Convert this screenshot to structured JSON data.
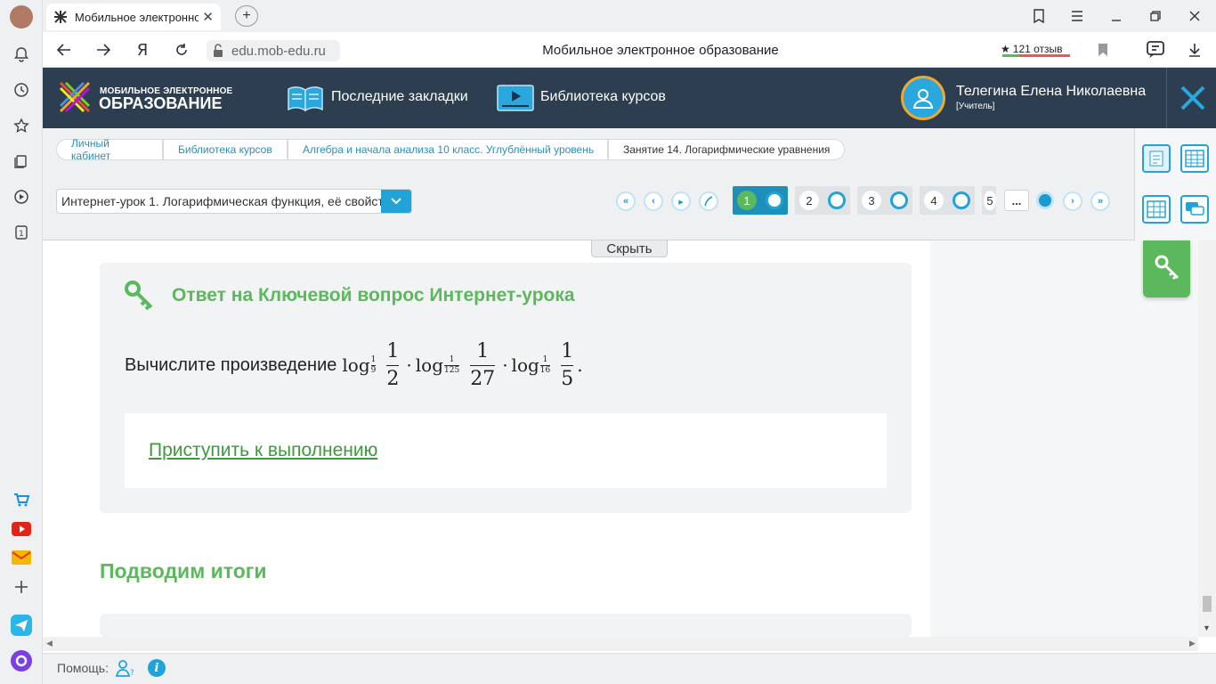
{
  "browser": {
    "tab_title": "Мобильное электронно",
    "address": "edu.mob-edu.ru",
    "page_title": "Мобильное электронное образование",
    "reviews": "121 отзыв"
  },
  "header": {
    "logo_top": "МОБИЛЬНОЕ ЭЛЕКТРОННОЕ",
    "logo_bottom": "ОБРАЗОВАНИЕ",
    "bookmarks": "Последние закладки",
    "library": "Библиотека курсов",
    "user_name": "Телегина Елена Николаевна",
    "user_role": "[Учитель]"
  },
  "breadcrumbs": [
    "Личный кабинет",
    "Библиотека курсов",
    "Алгебра и начала анализа 10 класс. Углублённый уровень",
    "Занятие 14. Логарифмические уравнения"
  ],
  "lesson_select": "Интернет-урок 1. Логарифмическая функция, её свойст",
  "pages": [
    "1",
    "2",
    "3",
    "4",
    "5"
  ],
  "pages_more": "...",
  "hide_button": "Скрыть",
  "content": {
    "card_title": "Ответ на Ключевой вопрос Интернет-урока",
    "task_prefix": "Вычислите произведение",
    "math": {
      "log": "log",
      "dot": "·",
      "period": ".",
      "b1_num": "1",
      "b1_den": "9",
      "a1_num": "1",
      "a1_den": "2",
      "b2_num": "1",
      "b2_den": "125",
      "a2_num": "1",
      "a2_den": "27",
      "b3_num": "1",
      "b3_den": "16",
      "a3_num": "1",
      "a3_den": "5"
    },
    "start_link": "Приступить к выполнению",
    "summary_title": "Подводим итоги"
  },
  "footer": {
    "help_label": "Помощь:"
  },
  "colors": {
    "header_bg": "#2d3e50",
    "accent_green": "#5cb85c",
    "accent_blue": "#21a3d8"
  }
}
